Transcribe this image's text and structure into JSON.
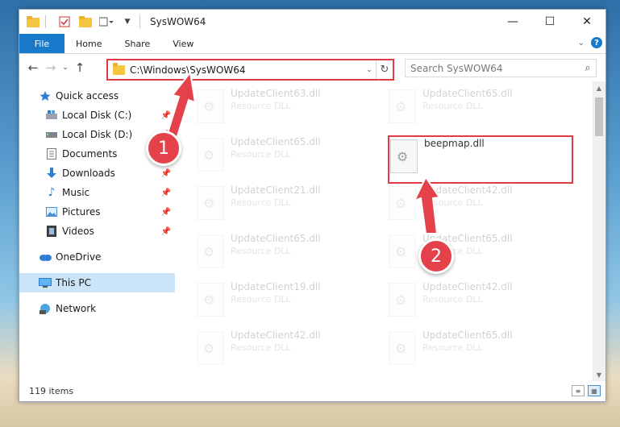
{
  "window": {
    "title": "SysWOW64",
    "minimize_icon": "minimize-icon",
    "maximize_icon": "maximize-icon",
    "close_icon": "close-icon"
  },
  "ribbon": {
    "tabs": [
      "File",
      "Home",
      "Share",
      "View"
    ]
  },
  "address": {
    "path": "C:\\Windows\\SysWOW64",
    "search_placeholder": "Search SysWOW64"
  },
  "nav": {
    "items": [
      {
        "label": "Quick access",
        "icon": "star-icon",
        "pinned": false
      },
      {
        "label": "Local Disk (C:)",
        "icon": "drive-icon",
        "pinned": true
      },
      {
        "label": "Local Disk (D:)",
        "icon": "drive-icon",
        "pinned": true
      },
      {
        "label": "Documents",
        "icon": "document-icon",
        "pinned": true
      },
      {
        "label": "Downloads",
        "icon": "download-icon",
        "pinned": true
      },
      {
        "label": "Music",
        "icon": "music-icon",
        "pinned": true
      },
      {
        "label": "Pictures",
        "icon": "pictures-icon",
        "pinned": true
      },
      {
        "label": "Videos",
        "icon": "videos-icon",
        "pinned": true
      },
      {
        "label": "OneDrive",
        "icon": "cloud-icon",
        "pinned": false
      },
      {
        "label": "This PC",
        "icon": "computer-icon",
        "pinned": false,
        "selected": true
      },
      {
        "label": "Network",
        "icon": "network-icon",
        "pinned": false
      }
    ]
  },
  "files": {
    "left_column": [
      {
        "name": "UpdateClient63.dll",
        "type": "Resource DLL"
      },
      {
        "name": "UpdateClient65.dll",
        "type": "Resource DLL"
      },
      {
        "name": "UpdateClient21.dll",
        "type": "Resource DLL"
      },
      {
        "name": "UpdateClient65.dll",
        "type": "Resource DLL"
      },
      {
        "name": "UpdateClient19.dll",
        "type": "Resource DLL"
      },
      {
        "name": "UpdateClient42.dll",
        "type": "Resource DLL"
      }
    ],
    "right_column": [
      {
        "name": "UpdateClient65.dll",
        "type": "Resource DLL"
      },
      {
        "name": "beepmap.dll",
        "type": ""
      },
      {
        "name": "UpdateClient42.dll",
        "type": "Resource DLL"
      },
      {
        "name": "UpdateClient65.dll",
        "type": "Resource DLL"
      },
      {
        "name": "UpdateClient42.dll",
        "type": "Resource DLL"
      },
      {
        "name": "UpdateClient65.dll",
        "type": "Resource DLL"
      }
    ]
  },
  "status": {
    "count": "119 items"
  },
  "annotations": {
    "step1": "1",
    "step2": "2",
    "color": "#e5414a"
  }
}
